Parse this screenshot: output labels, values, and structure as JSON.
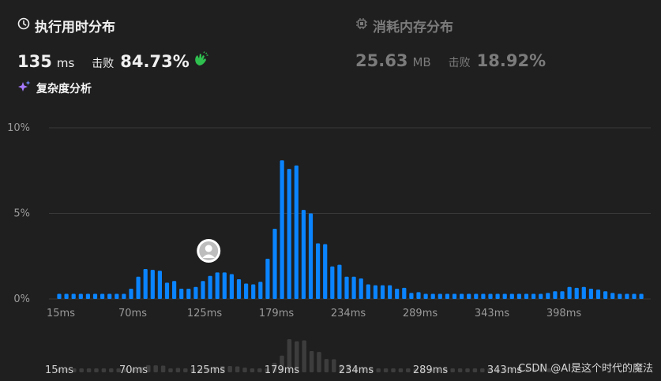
{
  "runtime": {
    "title": "执行用时分布",
    "value": "135",
    "unit": "ms",
    "beats_label": "击败",
    "beats_value": "84.73%"
  },
  "memory": {
    "title": "消耗内存分布",
    "value": "25.63",
    "unit": "MB",
    "beats_label": "击败",
    "beats_value": "18.92%"
  },
  "complexity": {
    "label": "复杂度分析"
  },
  "watermark": "CSDN @AI是这个时代的魔法",
  "colors": {
    "bar": "#0a84ff",
    "grid": "#3a3a3a",
    "axis_text": "#9a9a9a"
  },
  "chart_data": {
    "type": "bar",
    "y_ticks": [
      "10%",
      "5%",
      "0%"
    ],
    "ylim": [
      0,
      10
    ],
    "x_ticks": [
      "15ms",
      "70ms",
      "125ms",
      "179ms",
      "234ms",
      "289ms",
      "343ms",
      "398ms"
    ],
    "marker_bar_index": 22,
    "values": [
      0.3,
      0.3,
      0.3,
      0.3,
      0.3,
      0.3,
      0.3,
      0.3,
      0.3,
      0.3,
      0.6,
      1.3,
      1.75,
      1.7,
      1.65,
      0.95,
      1.05,
      0.6,
      0.6,
      0.7,
      1.05,
      1.35,
      1.55,
      1.55,
      1.45,
      1.15,
      0.9,
      0.85,
      1.0,
      2.35,
      4.1,
      8.1,
      7.6,
      7.8,
      5.2,
      5.0,
      3.25,
      3.2,
      1.9,
      2.0,
      1.3,
      1.3,
      1.2,
      0.85,
      0.8,
      0.8,
      0.8,
      0.6,
      0.65,
      0.35,
      0.4,
      0.3,
      0.3,
      0.3,
      0.3,
      0.3,
      0.3,
      0.3,
      0.3,
      0.3,
      0.3,
      0.3,
      0.3,
      0.3,
      0.3,
      0.3,
      0.3,
      0.3,
      0.35,
      0.45,
      0.45,
      0.7,
      0.65,
      0.7,
      0.6,
      0.55,
      0.45,
      0.35,
      0.3,
      0.3,
      0.3,
      0.3
    ]
  },
  "mini_chart": {
    "x_ticks": [
      "15ms",
      "70ms",
      "125ms",
      "179ms",
      "234ms",
      "289ms",
      "343ms"
    ]
  }
}
